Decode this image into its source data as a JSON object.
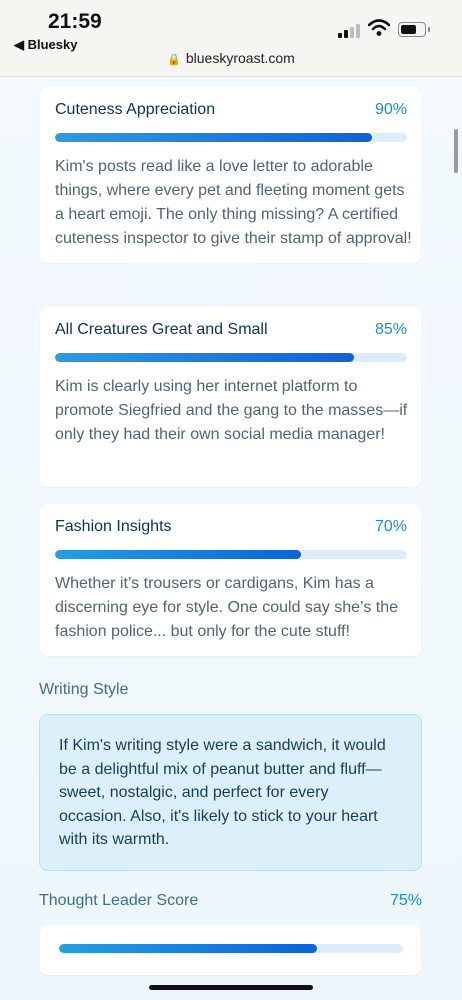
{
  "status": {
    "time": "21:59",
    "back_label": "◀ Bluesky",
    "url": "blueskyroast.com"
  },
  "cards": [
    {
      "title": "Cuteness Appreciation",
      "percent_label": "90%",
      "percent": 0.9,
      "desc": "Kim's posts read like a love letter to adorable things, where every pet and fleeting moment gets a heart emoji. The only thing missing? A certified cuteness inspector to give their stamp of approval!"
    },
    {
      "title": "All Creatures Great and Small",
      "percent_label": "85%",
      "percent": 0.85,
      "desc": "Kim is clearly using her internet platform to promote Siegfried and the gang to the masses—if only they had their own social media manager!"
    },
    {
      "title": "Fashion Insights",
      "percent_label": "70%",
      "percent": 0.7,
      "desc": "Whether it’s trousers or cardigans, Kim has a discerning eye for style. One could say she’s the fashion police... but only for the cute stuff!"
    }
  ],
  "writing_style": {
    "heading": "Writing Style",
    "text": "If Kim's writing style were a sandwich, it would be a delightful mix of peanut butter and fluff—sweet, nostalgic, and perfect for every occasion. Also, it's likely to stick to your heart with its warmth."
  },
  "thought_leader": {
    "heading": "Thought Leader Score",
    "percent_label": "75%",
    "percent": 0.75
  },
  "colors": {
    "accent": "#1a8fd0",
    "bar_fill": "#0d62d8",
    "bar_track": "#dcecf8",
    "writing_bg": "#dcf0fa"
  }
}
